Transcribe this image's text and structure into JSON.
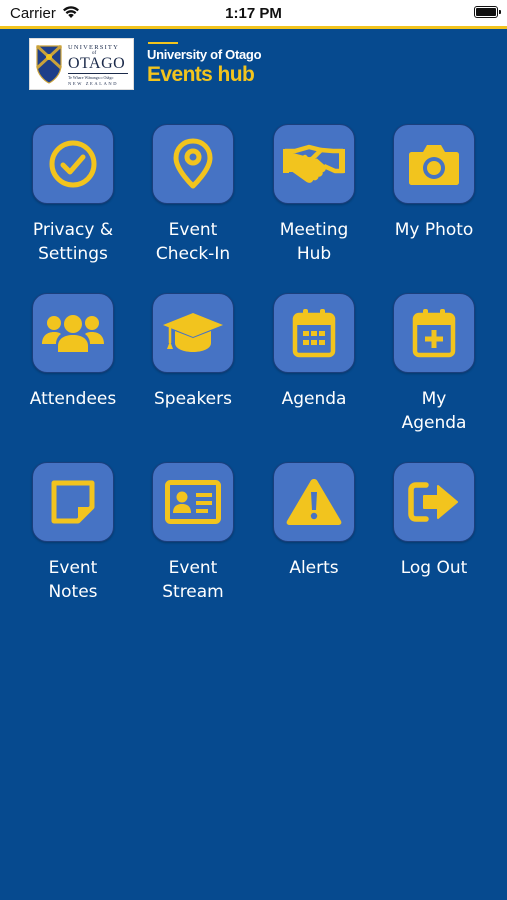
{
  "status_bar": {
    "carrier": "Carrier",
    "time": "1:17 PM"
  },
  "logo": {
    "university_text": "UNIVERSITY",
    "of_text": "of",
    "otago_text": "OTAGO",
    "maori_text": "Te Whare Wānanga o Otāgo",
    "country_text": "NEW ZEALAND"
  },
  "brand": {
    "university": "University of Otago",
    "app_name": "Events hub"
  },
  "colors": {
    "background": "#064a8f",
    "tile": "#4673c4",
    "accent": "#f2c41e",
    "text": "#ffffff"
  },
  "menu": [
    {
      "icon": "check-circle-icon",
      "line1": "Privacy &",
      "line2": "Settings"
    },
    {
      "icon": "location-pin-icon",
      "line1": "Event",
      "line2": "Check-In"
    },
    {
      "icon": "handshake-icon",
      "line1": "Meeting",
      "line2": "Hub"
    },
    {
      "icon": "camera-icon",
      "line1": "My Photo",
      "line2": ""
    },
    {
      "icon": "users-icon",
      "line1": "Attendees",
      "line2": ""
    },
    {
      "icon": "graduation-cap-icon",
      "line1": "Speakers",
      "line2": ""
    },
    {
      "icon": "calendar-icon",
      "line1": "Agenda",
      "line2": ""
    },
    {
      "icon": "calendar-plus-icon",
      "line1": "My",
      "line2": "Agenda"
    },
    {
      "icon": "sticky-note-icon",
      "line1": "Event",
      "line2": "Notes"
    },
    {
      "icon": "id-card-icon",
      "line1": "Event",
      "line2": "Stream"
    },
    {
      "icon": "warning-icon",
      "line1": "Alerts",
      "line2": ""
    },
    {
      "icon": "sign-out-icon",
      "line1": "Log Out",
      "line2": ""
    }
  ]
}
